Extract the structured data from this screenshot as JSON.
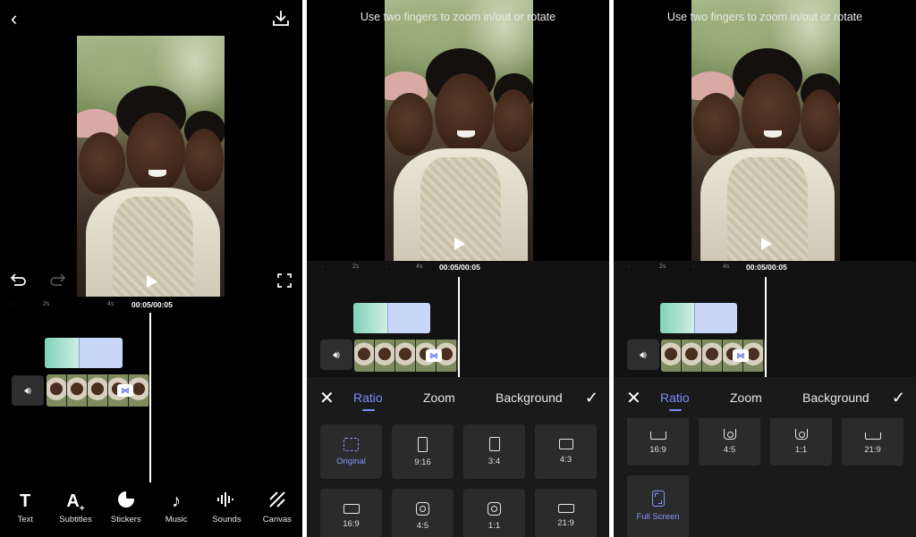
{
  "editor": {
    "back_icon": "chevron-left-icon",
    "download_icon": "download-icon",
    "undo_icon": "undo-icon",
    "redo_icon": "redo-icon",
    "fullscreen_icon": "fullscreen-icon",
    "timecode": "00:05/00:05",
    "ruler_labels": [
      "2s",
      "4s"
    ],
    "toolbar": [
      {
        "label": "Text",
        "icon": "text-icon"
      },
      {
        "label": "Subtitles",
        "icon": "subtitles-icon"
      },
      {
        "label": "Stickers",
        "icon": "stickers-icon"
      },
      {
        "label": "Music",
        "icon": "music-icon"
      },
      {
        "label": "Sounds",
        "icon": "sounds-icon"
      },
      {
        "label": "Canvas",
        "icon": "canvas-icon"
      }
    ]
  },
  "ratio_screen": {
    "hint": "Use two fingers to zoom in/out or rotate",
    "timecode": "00:05/00:05",
    "ruler_labels": [
      "2s",
      "4s"
    ],
    "tabs": [
      "Ratio",
      "Zoom",
      "Background"
    ],
    "active_tab": "Ratio",
    "options_grid_a": [
      "Original",
      "9:16",
      "3:4",
      "4:3",
      "16:9",
      "4:5",
      "1:1",
      "21:9"
    ],
    "options_grid_b": [
      "16:9",
      "4:5",
      "1:1",
      "21:9",
      "Full Screen"
    ],
    "selected_a": "Original",
    "selected_b": "Full Screen"
  },
  "colors": {
    "accent": "#7b8cff",
    "background": "#000000",
    "sheet": "#1a1a1a",
    "tile": "#2b2b2b"
  }
}
